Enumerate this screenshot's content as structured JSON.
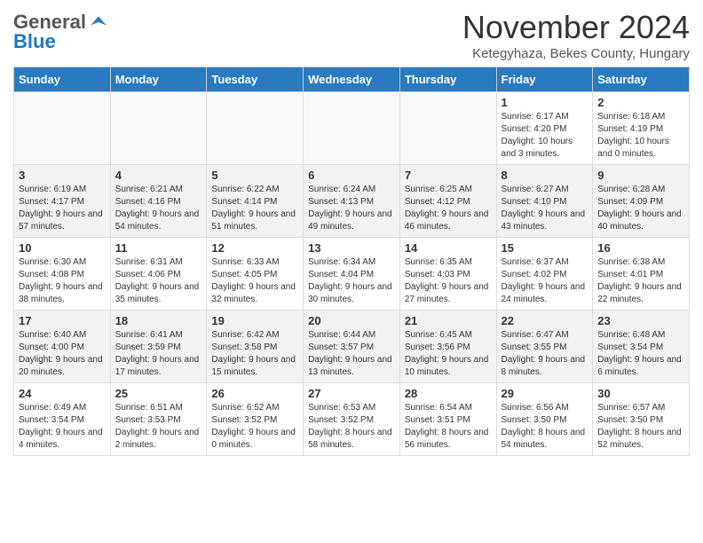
{
  "logo": {
    "general": "General",
    "blue": "Blue"
  },
  "header": {
    "month": "November 2024",
    "location": "Ketegyhaza, Bekes County, Hungary"
  },
  "weekdays": [
    "Sunday",
    "Monday",
    "Tuesday",
    "Wednesday",
    "Thursday",
    "Friday",
    "Saturday"
  ],
  "weeks": [
    [
      {
        "day": "",
        "info": ""
      },
      {
        "day": "",
        "info": ""
      },
      {
        "day": "",
        "info": ""
      },
      {
        "day": "",
        "info": ""
      },
      {
        "day": "",
        "info": ""
      },
      {
        "day": "1",
        "info": "Sunrise: 6:17 AM\nSunset: 4:20 PM\nDaylight: 10 hours\nand 3 minutes."
      },
      {
        "day": "2",
        "info": "Sunrise: 6:18 AM\nSunset: 4:19 PM\nDaylight: 10 hours\nand 0 minutes."
      }
    ],
    [
      {
        "day": "3",
        "info": "Sunrise: 6:19 AM\nSunset: 4:17 PM\nDaylight: 9 hours\nand 57 minutes."
      },
      {
        "day": "4",
        "info": "Sunrise: 6:21 AM\nSunset: 4:16 PM\nDaylight: 9 hours\nand 54 minutes."
      },
      {
        "day": "5",
        "info": "Sunrise: 6:22 AM\nSunset: 4:14 PM\nDaylight: 9 hours\nand 51 minutes."
      },
      {
        "day": "6",
        "info": "Sunrise: 6:24 AM\nSunset: 4:13 PM\nDaylight: 9 hours\nand 49 minutes."
      },
      {
        "day": "7",
        "info": "Sunrise: 6:25 AM\nSunset: 4:12 PM\nDaylight: 9 hours\nand 46 minutes."
      },
      {
        "day": "8",
        "info": "Sunrise: 6:27 AM\nSunset: 4:10 PM\nDaylight: 9 hours\nand 43 minutes."
      },
      {
        "day": "9",
        "info": "Sunrise: 6:28 AM\nSunset: 4:09 PM\nDaylight: 9 hours\nand 40 minutes."
      }
    ],
    [
      {
        "day": "10",
        "info": "Sunrise: 6:30 AM\nSunset: 4:08 PM\nDaylight: 9 hours\nand 38 minutes."
      },
      {
        "day": "11",
        "info": "Sunrise: 6:31 AM\nSunset: 4:06 PM\nDaylight: 9 hours\nand 35 minutes."
      },
      {
        "day": "12",
        "info": "Sunrise: 6:33 AM\nSunset: 4:05 PM\nDaylight: 9 hours\nand 32 minutes."
      },
      {
        "day": "13",
        "info": "Sunrise: 6:34 AM\nSunset: 4:04 PM\nDaylight: 9 hours\nand 30 minutes."
      },
      {
        "day": "14",
        "info": "Sunrise: 6:35 AM\nSunset: 4:03 PM\nDaylight: 9 hours\nand 27 minutes."
      },
      {
        "day": "15",
        "info": "Sunrise: 6:37 AM\nSunset: 4:02 PM\nDaylight: 9 hours\nand 24 minutes."
      },
      {
        "day": "16",
        "info": "Sunrise: 6:38 AM\nSunset: 4:01 PM\nDaylight: 9 hours\nand 22 minutes."
      }
    ],
    [
      {
        "day": "17",
        "info": "Sunrise: 6:40 AM\nSunset: 4:00 PM\nDaylight: 9 hours\nand 20 minutes."
      },
      {
        "day": "18",
        "info": "Sunrise: 6:41 AM\nSunset: 3:59 PM\nDaylight: 9 hours\nand 17 minutes."
      },
      {
        "day": "19",
        "info": "Sunrise: 6:42 AM\nSunset: 3:58 PM\nDaylight: 9 hours\nand 15 minutes."
      },
      {
        "day": "20",
        "info": "Sunrise: 6:44 AM\nSunset: 3:57 PM\nDaylight: 9 hours\nand 13 minutes."
      },
      {
        "day": "21",
        "info": "Sunrise: 6:45 AM\nSunset: 3:56 PM\nDaylight: 9 hours\nand 10 minutes."
      },
      {
        "day": "22",
        "info": "Sunrise: 6:47 AM\nSunset: 3:55 PM\nDaylight: 9 hours\nand 8 minutes."
      },
      {
        "day": "23",
        "info": "Sunrise: 6:48 AM\nSunset: 3:54 PM\nDaylight: 9 hours\nand 6 minutes."
      }
    ],
    [
      {
        "day": "24",
        "info": "Sunrise: 6:49 AM\nSunset: 3:54 PM\nDaylight: 9 hours\nand 4 minutes."
      },
      {
        "day": "25",
        "info": "Sunrise: 6:51 AM\nSunset: 3:53 PM\nDaylight: 9 hours\nand 2 minutes."
      },
      {
        "day": "26",
        "info": "Sunrise: 6:52 AM\nSunset: 3:52 PM\nDaylight: 9 hours\nand 0 minutes."
      },
      {
        "day": "27",
        "info": "Sunrise: 6:53 AM\nSunset: 3:52 PM\nDaylight: 8 hours\nand 58 minutes."
      },
      {
        "day": "28",
        "info": "Sunrise: 6:54 AM\nSunset: 3:51 PM\nDaylight: 8 hours\nand 56 minutes."
      },
      {
        "day": "29",
        "info": "Sunrise: 6:56 AM\nSunset: 3:50 PM\nDaylight: 8 hours\nand 54 minutes."
      },
      {
        "day": "30",
        "info": "Sunrise: 6:57 AM\nSunset: 3:50 PM\nDaylight: 8 hours\nand 52 minutes."
      }
    ]
  ]
}
